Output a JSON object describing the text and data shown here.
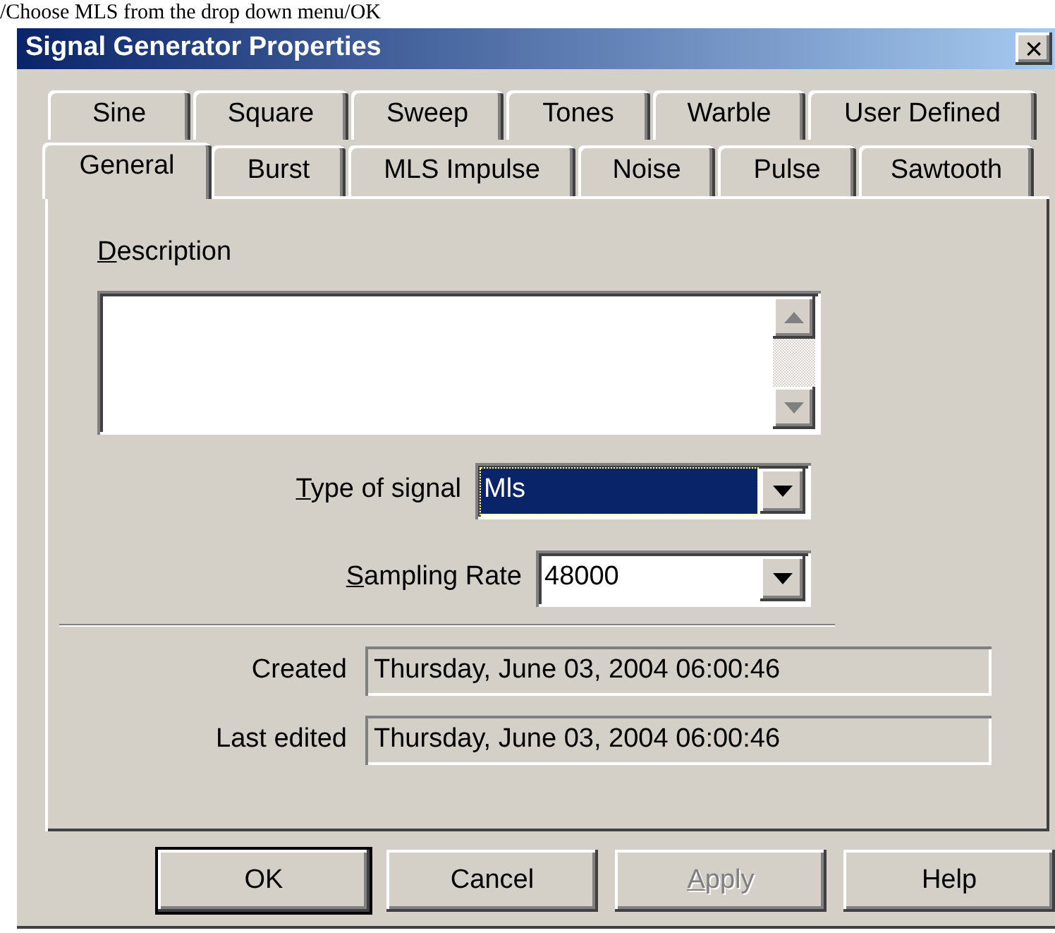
{
  "caption": "/Choose MLS from the drop down menu/OK",
  "window": {
    "title": "Signal Generator Properties",
    "close": "×"
  },
  "tab_rows": [
    [
      {
        "label": "Sine",
        "selected": false
      },
      {
        "label": "Square",
        "selected": false
      },
      {
        "label": "Sweep",
        "selected": false
      },
      {
        "label": "Tones",
        "selected": false
      },
      {
        "label": "Warble",
        "selected": false
      },
      {
        "label": "User Defined",
        "selected": false
      }
    ],
    [
      {
        "label": "General",
        "selected": true
      },
      {
        "label": "Burst",
        "selected": false
      },
      {
        "label": "MLS Impulse",
        "selected": false
      },
      {
        "label": "Noise",
        "selected": false
      },
      {
        "label": "Pulse",
        "selected": false
      },
      {
        "label": "Sawtooth",
        "selected": false
      }
    ]
  ],
  "description": {
    "label": "Description",
    "access_key": true
  },
  "type_of_signal": {
    "label": "Type of signal",
    "access_key": true,
    "value": "Mls",
    "focused": true
  },
  "sampling_rate": {
    "label": "Sampling Rate",
    "access_key": true,
    "value": "48000",
    "focused": false
  },
  "info": [
    {
      "label": "Created",
      "value": "Thursday, June 03, 2004 06:00:46"
    },
    {
      "label": "Last edited",
      "value": "Thursday, June 03, 2004 06:00:46"
    }
  ],
  "buttons": [
    {
      "label": "OK",
      "default": true,
      "disabled": false,
      "access_key": false
    },
    {
      "label": "Cancel",
      "default": false,
      "disabled": false,
      "access_key": false
    },
    {
      "label": "Apply",
      "default": false,
      "disabled": true,
      "access_key": true
    },
    {
      "label": "Help",
      "default": false,
      "disabled": false,
      "access_key": false
    }
  ]
}
